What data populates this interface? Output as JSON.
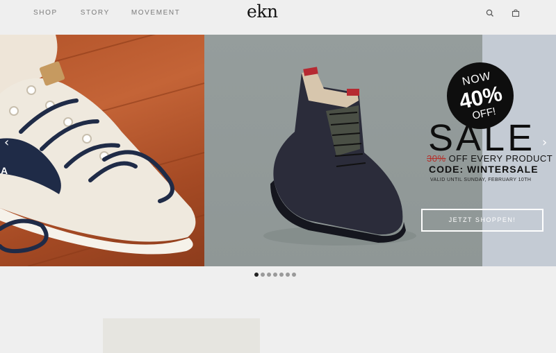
{
  "nav": {
    "items": [
      {
        "label": "SHOP"
      },
      {
        "label": "STORY"
      },
      {
        "label": "MOVEMENT"
      }
    ]
  },
  "logo": "ekn",
  "header_icons": [
    "search-icon",
    "bag-icon"
  ],
  "hero": {
    "left_letter": "A",
    "badge": {
      "now": "NOW",
      "percent": "40%",
      "off": "OFF!"
    },
    "sale_title": "SALE",
    "old_offer": "30%",
    "offer_text": " OFF EVERY PRODUCT",
    "code": "CODE: WINTERSALE",
    "valid": "VALID UNTIL SUNDAY, FEBRUARY 10TH",
    "cta": "JETZT SHOPPEN!",
    "prev_arrow": "‹",
    "next_arrow": "›"
  },
  "carousel": {
    "count": 7,
    "active_index": 0
  },
  "colors": {
    "background": "#efefef",
    "badge": "#0e0e0e",
    "strike": "#b5302a",
    "nav_text": "#7a7a7a"
  }
}
